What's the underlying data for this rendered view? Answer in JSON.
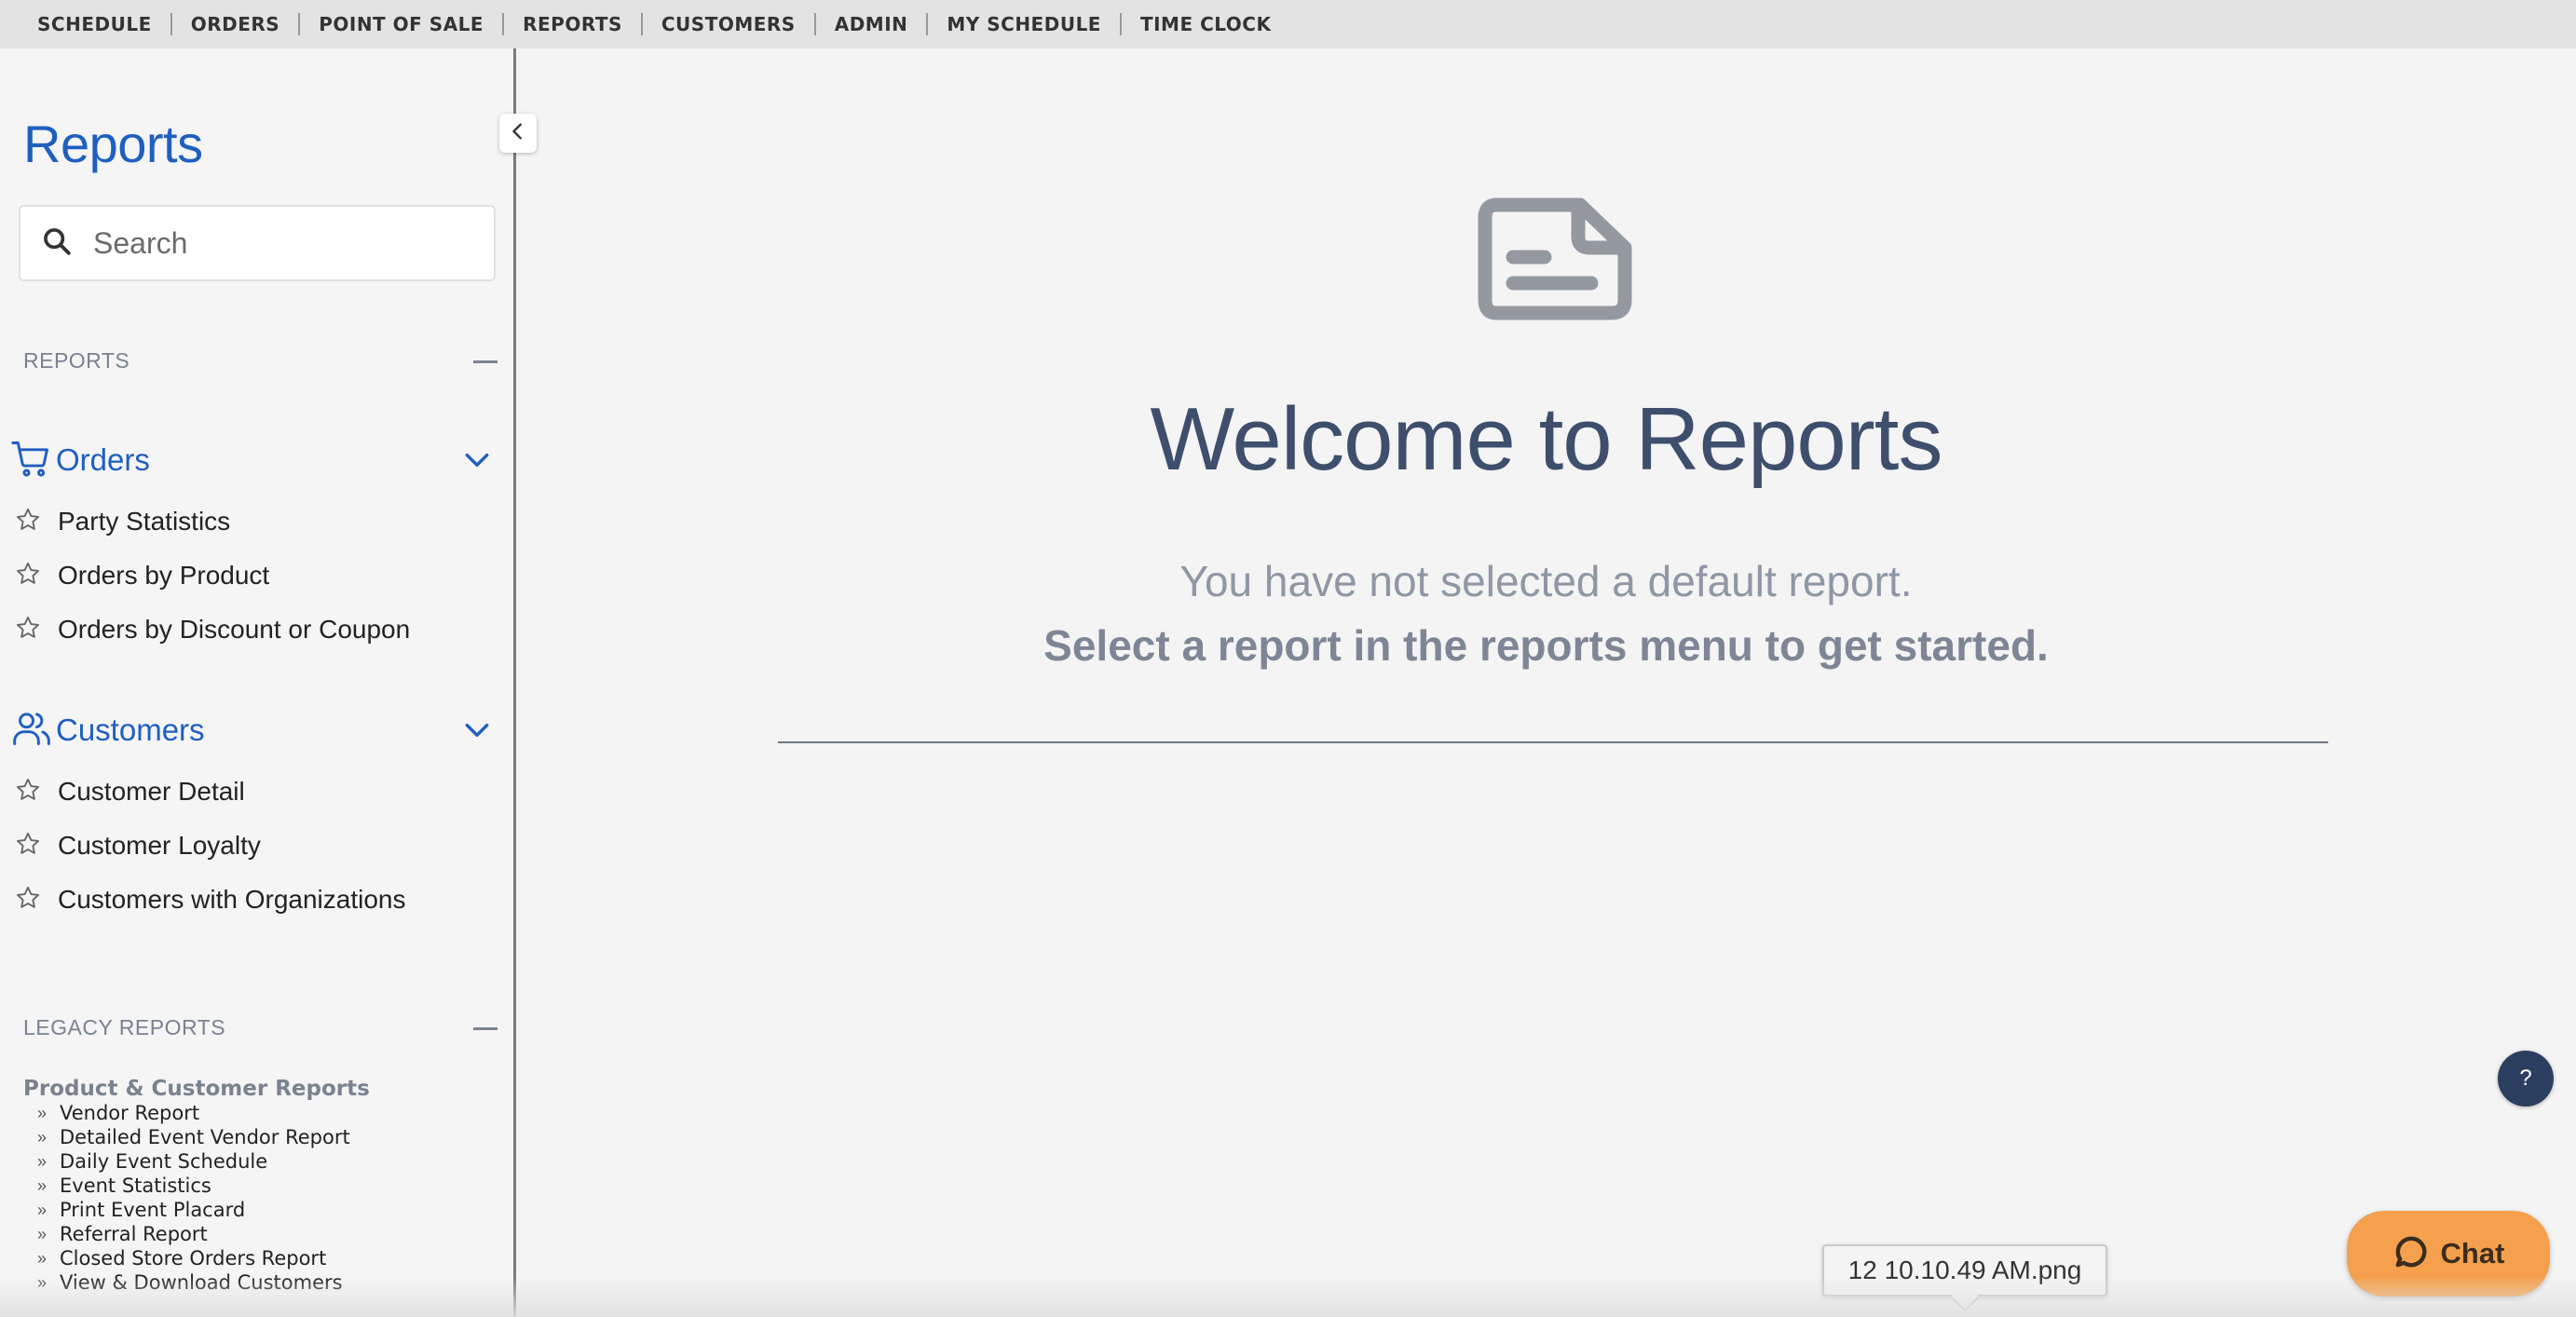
{
  "topnav": {
    "items": [
      "SCHEDULE",
      "ORDERS",
      "POINT OF SALE",
      "REPORTS",
      "CUSTOMERS",
      "ADMIN",
      "MY SCHEDULE",
      "TIME CLOCK"
    ]
  },
  "sidebar": {
    "title": "Reports",
    "search_placeholder": "Search",
    "reports_label": "REPORTS",
    "groups": [
      {
        "label": "Orders",
        "icon": "cart-icon",
        "items": [
          "Party Statistics",
          "Orders by Product",
          "Orders by Discount or Coupon"
        ]
      },
      {
        "label": "Customers",
        "icon": "users-icon",
        "items": [
          "Customer Detail",
          "Customer Loyalty",
          "Customers with Organizations"
        ]
      }
    ],
    "legacy_label": "LEGACY REPORTS",
    "legacy_group": "Product & Customer Reports",
    "legacy_items": [
      "Vendor Report",
      "Detailed Event Vendor Report",
      "Daily Event Schedule",
      "Event Statistics",
      "Print Event Placard",
      "Referral Report",
      "Closed Store Orders Report",
      "View & Download Customers"
    ]
  },
  "main": {
    "heading": "Welcome to Reports",
    "line1": "You have not selected a default report.",
    "line2": "Select a report in the reports menu to get started."
  },
  "widgets": {
    "help_label": "?",
    "chat_label": "Chat",
    "tooltip_text": "12 10.10.49 AM.png"
  },
  "colors": {
    "accent": "#1f5fbf",
    "heading": "#3e4f6d",
    "chat": "#f5a04c",
    "help": "#2c3e5f"
  }
}
